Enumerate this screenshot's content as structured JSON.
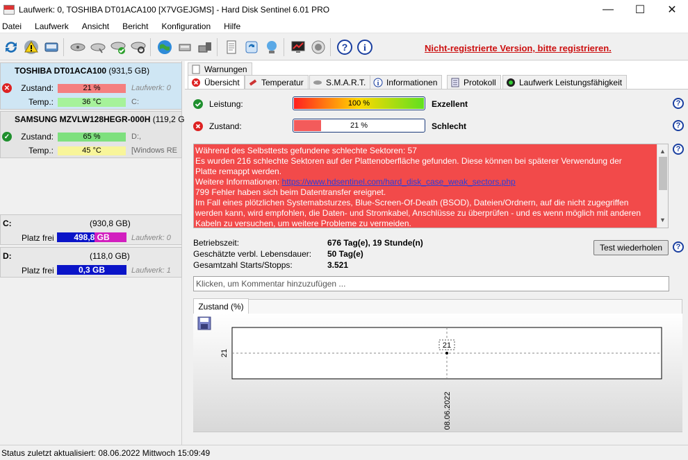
{
  "window": {
    "title": "Laufwerk: 0, TOSHIBA DT01ACA100 [X7VGEJGMS]  -  Hard Disk Sentinel 6.01 PRO",
    "minimize": "—",
    "maximize": "☐",
    "close": "✕"
  },
  "menu": [
    "Datei",
    "Laufwerk",
    "Ansicht",
    "Bericht",
    "Konfiguration",
    "Hilfe"
  ],
  "registration_notice": "Nicht-registrierte Version, bitte registrieren.",
  "disks": [
    {
      "model": "TOSHIBA DT01ACA100",
      "size": "(931,5 GB)",
      "status_label": "Zustand:",
      "status_value": "21 %",
      "status_fill": 21,
      "temp_label": "Temp.:",
      "temp_value": "36 °C",
      "drive_info": "Laufwerk: 0",
      "letter": "C:"
    },
    {
      "model": "SAMSUNG MZVLW128HEGR-000H",
      "size": "(119,2 GB)",
      "status_label": "Zustand:",
      "status_value": "65 %",
      "status_fill": 65,
      "temp_label": "Temp.:",
      "temp_value": "45 °C",
      "drive_info": "D:,",
      "letter": "[Windows RE"
    }
  ],
  "volumes": [
    {
      "name": "C:",
      "size": "(930,8 GB)",
      "free_label": "Platz frei",
      "free_value": "498,8 GB",
      "free_fraction": 0.536,
      "drive_info": "Laufwerk: 0"
    },
    {
      "name": "D:",
      "size": "(118,0 GB)",
      "free_label": "Platz frei",
      "free_value": "0,3 GB",
      "free_fraction": 0.003,
      "drive_info": "Laufwerk: 1"
    }
  ],
  "tabs_row1": [
    "Warnungen"
  ],
  "tabs_row2": [
    "Übersicht",
    "Temperatur",
    "S.M.A.R.T.",
    "Informationen",
    "Protokoll",
    "Laufwerk Leistungsfähigkeit"
  ],
  "overview": {
    "performance_label": "Leistung:",
    "performance_value": "100 %",
    "performance_fill": 100,
    "performance_rating": "Exzellent",
    "health_label": "Zustand:",
    "health_value": "21 %",
    "health_fill": 21,
    "health_rating": "Schlecht",
    "message_lines": [
      "Während des Selbsttests gefundene schlechte Sektoren: 57",
      "Es wurden 216 schlechte Sektoren auf der Plattenoberfläche gefunden. Diese können bei späterer Verwendung der",
      "Platte remappt werden."
    ],
    "more_info_label": "Weitere Informationen: ",
    "more_info_link": "https://www.hdsentinel.com/hard_disk_case_weak_sectors.php",
    "message_lines2": [
      "799 Fehler haben sich beim Datentransfer ereignet.",
      "Im Fall eines plötzlichen Systemabsturzes, Blue-Screen-Of-Death (BSOD), Dateien/Ordnern, auf die nicht zugegriffen",
      "werden kann, wird empfohlen, die Daten- und Stromkabel, Anschlüsse zu überprüfen - und es wenn möglich mit anderen",
      "Kabeln zu versuchen, um weitere Probleme zu vermeiden."
    ],
    "uptime_label": "Betriebszeit:",
    "uptime_value": "676 Tag(e), 19 Stunde(n)",
    "lifetime_label": "Geschätzte verbl. Lebensdauer:",
    "lifetime_value": "50 Tag(e)",
    "startstop_label": "Gesamtzahl Starts/Stopps:",
    "startstop_value": "3.521",
    "retest_button": "Test wiederholen",
    "comment_placeholder": "Klicken, um Kommentar hinzuzufügen ..."
  },
  "chart_tab": "Zustand (%)",
  "chart_data": {
    "type": "line",
    "x": [
      "08.06.2022"
    ],
    "series": [
      {
        "values": [
          21
        ]
      }
    ],
    "yticks": [
      "21"
    ],
    "data_labels": [
      "21"
    ]
  },
  "statusbar": "Status zuletzt aktualisiert: 08.06.2022 Mittwoch 15:09:49",
  "colors": {
    "health_bad": "#f35b5b",
    "health_ok": "#7ee07e",
    "temp_ok": "#a6f29a",
    "temp_warn": "#f8f59a",
    "free_high": "#d21fbf",
    "free_low": "#0a14c8",
    "message_bg": "#f24a4a"
  }
}
